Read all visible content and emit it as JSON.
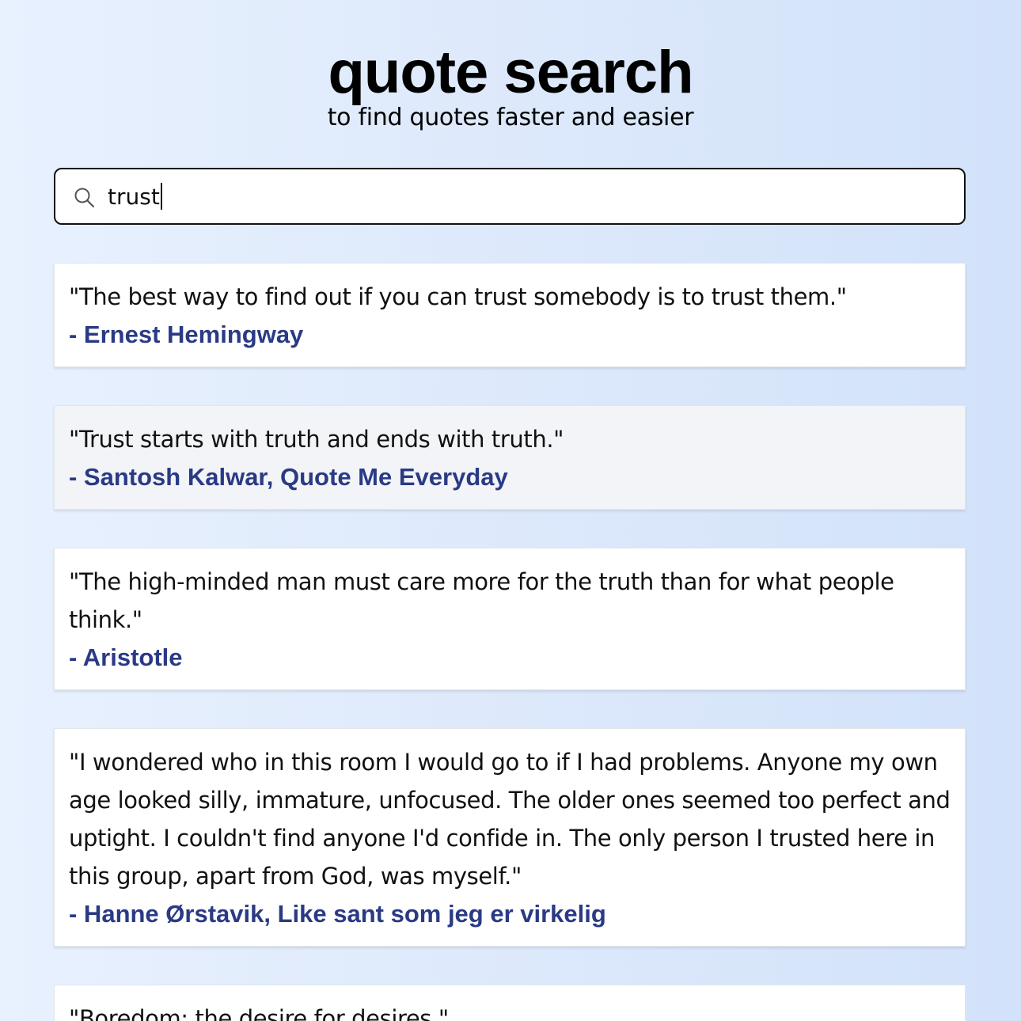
{
  "header": {
    "title": "quote search",
    "subtitle": "to find quotes faster and easier"
  },
  "search": {
    "value": "trust",
    "icon": "search-icon"
  },
  "colors": {
    "author": "#2a3a84",
    "card_hover": "#f2f4f7",
    "border": "#111111"
  },
  "results": [
    {
      "quote": "\"The best way to find out if you can trust somebody is to trust them.\"",
      "author": "- Ernest Hemingway"
    },
    {
      "quote": "\"Trust starts with truth and ends with truth.\"",
      "author": "- Santosh Kalwar, Quote Me Everyday"
    },
    {
      "quote": "\"The high-minded man must care more for the truth than for what people think.\"",
      "author": "- Aristotle"
    },
    {
      "quote": "\"I wondered who in this room I would go to if I had problems. Anyone my own age looked silly, immature, unfocused. The older ones seemed too perfect and uptight. I couldn't find anyone I'd confide in. The only person I trusted here in this group, apart from God, was myself.\"",
      "author": "- Hanne Ørstavik, Like sant som jeg er virkelig"
    },
    {
      "quote": "\"Boredom: the desire for desires.\"",
      "author": ""
    }
  ]
}
